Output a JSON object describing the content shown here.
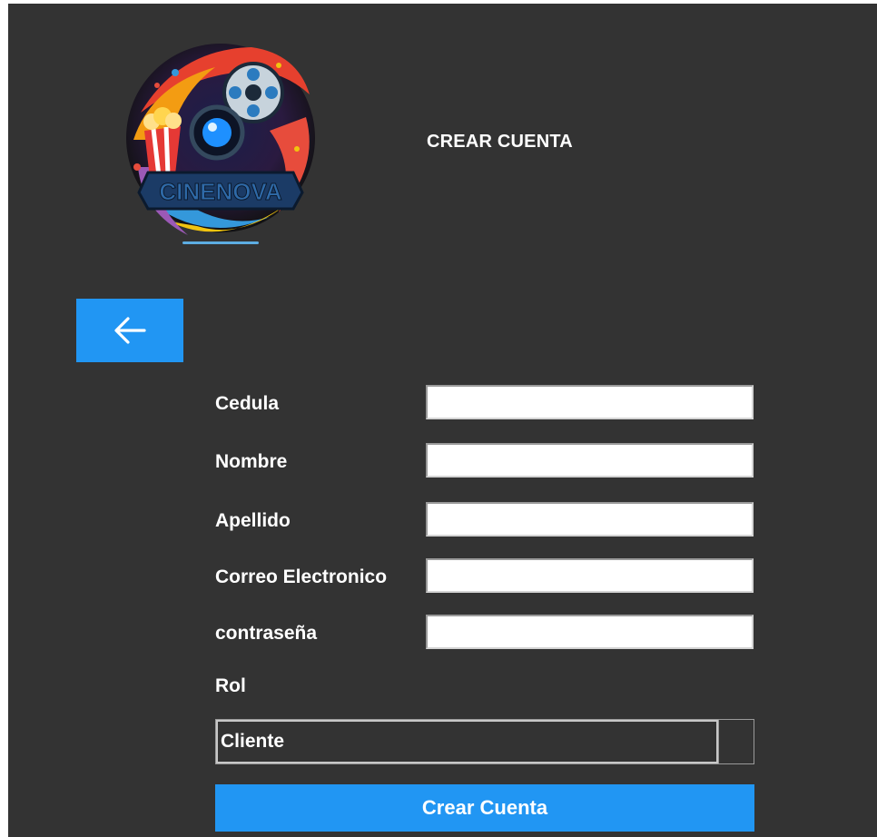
{
  "header": {
    "title": "CREAR CUENTA",
    "logo_text": "CINENOVA"
  },
  "form": {
    "fields": [
      {
        "label": "Cedula",
        "value": ""
      },
      {
        "label": "Nombre",
        "value": ""
      },
      {
        "label": "Apellido",
        "value": ""
      },
      {
        "label": "Correo Electronico",
        "value": ""
      },
      {
        "label": "contraseña",
        "value": ""
      }
    ],
    "role_label": "Rol",
    "role_selected": "Cliente",
    "submit_label": "Crear Cuenta"
  },
  "colors": {
    "background": "#333333",
    "accent": "#2196f3",
    "text": "#ffffff"
  },
  "icons": {
    "back": "arrow-left-icon",
    "dropdown": "chevron-down-icon"
  }
}
